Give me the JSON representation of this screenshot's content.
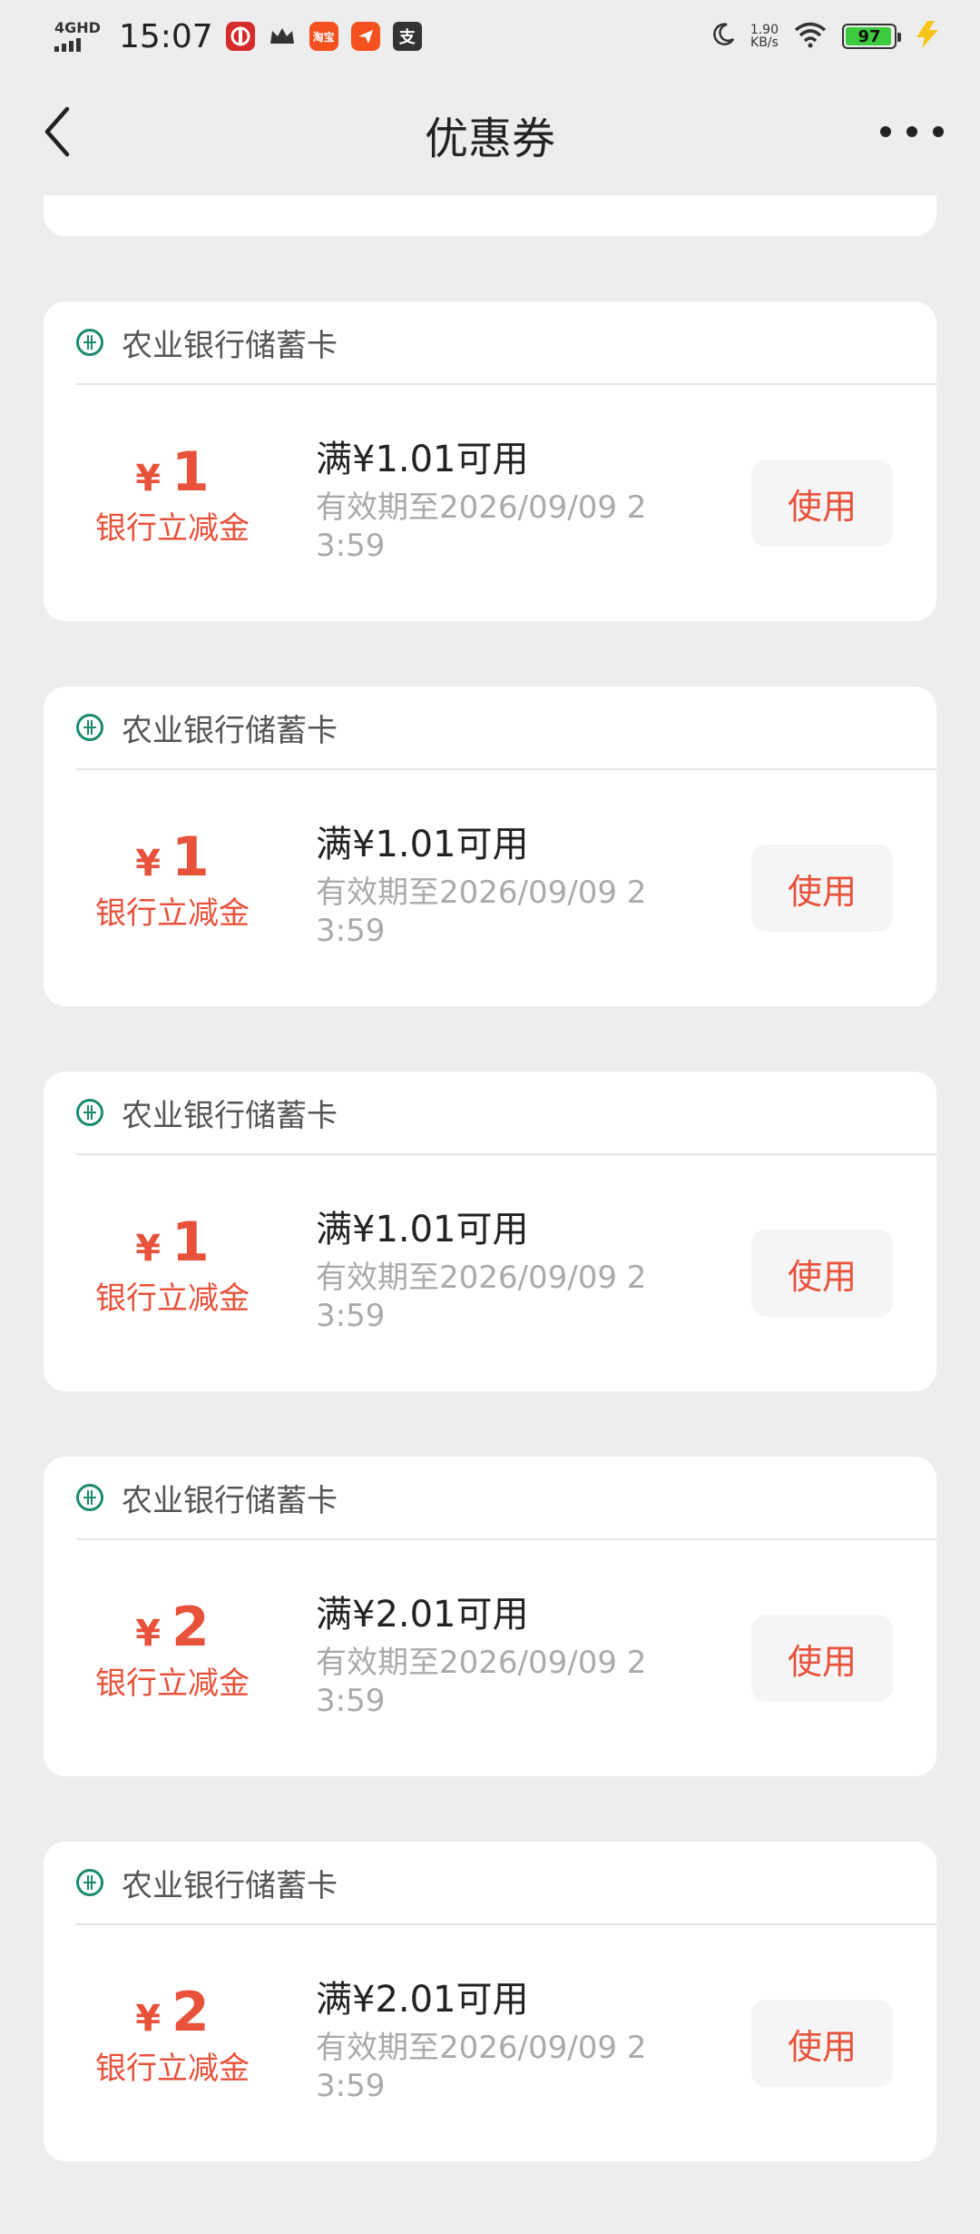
{
  "status_bar": {
    "network": "4GHD",
    "time": "15:07",
    "app_icons": [
      "bank-icon",
      "crown-icon",
      "taobao-icon",
      "send-icon",
      "alipay-icon"
    ],
    "taobao_label": "淘宝",
    "alipay_label": "支",
    "net_speed_value": "1.90",
    "net_speed_unit": "KB/s",
    "battery_level": "97"
  },
  "nav": {
    "title": "优惠券"
  },
  "colors": {
    "accent": "#E8513A",
    "bank_green": "#1A8A6D",
    "background": "#EDEDED"
  },
  "coupons": [
    {
      "bank": "农业银行储蓄卡",
      "symbol": "¥",
      "amount": "1",
      "label": "银行立减金",
      "threshold": "满¥1.01可用",
      "validity": "有效期至2026/09/09 23:59",
      "button": "使用"
    },
    {
      "bank": "农业银行储蓄卡",
      "symbol": "¥",
      "amount": "1",
      "label": "银行立减金",
      "threshold": "满¥1.01可用",
      "validity": "有效期至2026/09/09 23:59",
      "button": "使用"
    },
    {
      "bank": "农业银行储蓄卡",
      "symbol": "¥",
      "amount": "1",
      "label": "银行立减金",
      "threshold": "满¥1.01可用",
      "validity": "有效期至2026/09/09 23:59",
      "button": "使用"
    },
    {
      "bank": "农业银行储蓄卡",
      "symbol": "¥",
      "amount": "2",
      "label": "银行立减金",
      "threshold": "满¥2.01可用",
      "validity": "有效期至2026/09/09 23:59",
      "button": "使用"
    },
    {
      "bank": "农业银行储蓄卡",
      "symbol": "¥",
      "amount": "2",
      "label": "银行立减金",
      "threshold": "满¥2.01可用",
      "validity": "有效期至2026/09/09 23:59",
      "button": "使用"
    }
  ]
}
